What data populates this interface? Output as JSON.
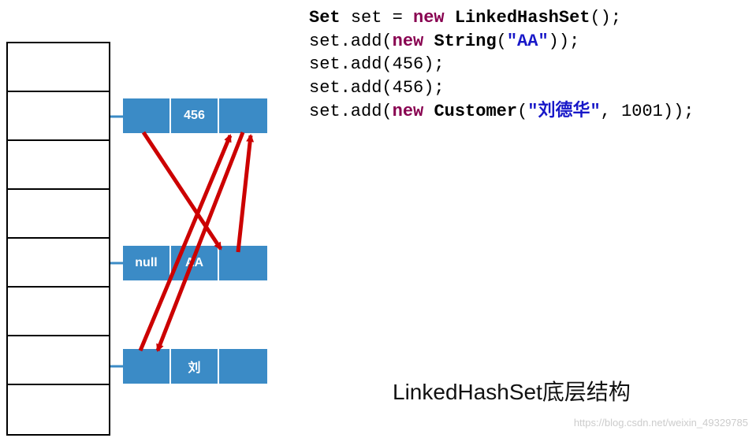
{
  "diagram": {
    "hash_table": {
      "rows": 8
    },
    "nodes": [
      {
        "prev": "",
        "value": "456",
        "next": ""
      },
      {
        "prev": "null",
        "value": "AA",
        "next": ""
      },
      {
        "prev": "",
        "value": "刘",
        "next": ""
      }
    ]
  },
  "code": {
    "lines": [
      {
        "tokens": [
          {
            "t": "Set ",
            "c": "typ"
          },
          {
            "t": "set = ",
            "c": ""
          },
          {
            "t": "new",
            "c": "kw"
          },
          {
            "t": " ",
            "c": ""
          },
          {
            "t": "LinkedHashSet",
            "c": "typ"
          },
          {
            "t": "();",
            "c": ""
          }
        ]
      },
      {
        "tokens": [
          {
            "t": "set.add(",
            "c": ""
          },
          {
            "t": "new",
            "c": "kw"
          },
          {
            "t": " ",
            "c": ""
          },
          {
            "t": "String",
            "c": "typ"
          },
          {
            "t": "(",
            "c": ""
          },
          {
            "t": "\"AA\"",
            "c": "str"
          },
          {
            "t": "));",
            "c": ""
          }
        ]
      },
      {
        "tokens": [
          {
            "t": "set.add(456);",
            "c": ""
          }
        ]
      },
      {
        "tokens": [
          {
            "t": "set.add(456);",
            "c": ""
          }
        ]
      },
      {
        "tokens": [
          {
            "t": "set.add(",
            "c": ""
          },
          {
            "t": "new",
            "c": "kw"
          },
          {
            "t": " ",
            "c": ""
          },
          {
            "t": "Customer",
            "c": "typ"
          },
          {
            "t": "(",
            "c": ""
          },
          {
            "t": "\"刘德华\"",
            "c": "str"
          },
          {
            "t": ", 1001));",
            "c": ""
          }
        ]
      }
    ]
  },
  "title": "LinkedHashSet底层结构",
  "watermark": "https://blog.csdn.net/weixin_49329785"
}
